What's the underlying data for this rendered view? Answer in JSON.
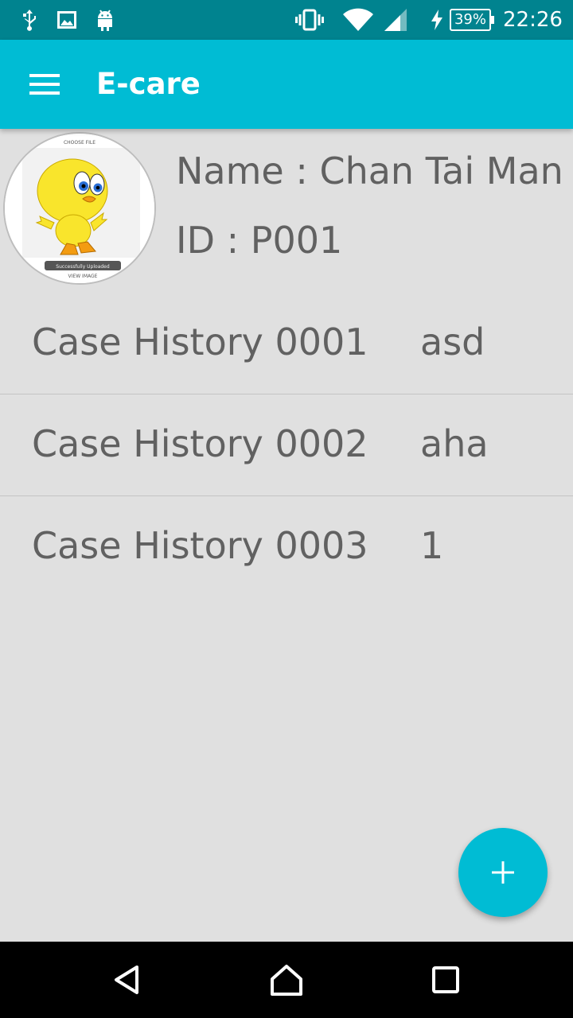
{
  "status_bar": {
    "icons": [
      "usb-icon",
      "image-icon",
      "android-icon",
      "vibrate-icon",
      "wifi-icon",
      "signal-icon",
      "charging-icon"
    ],
    "battery_label": "39%",
    "time": "22:26"
  },
  "app_bar": {
    "menu_icon": "menu-icon",
    "title": "E-care",
    "color": "#00bcd4"
  },
  "profile": {
    "avatar_icon": "avatar-image",
    "avatar_caption_top": "CHOOSE FILE",
    "avatar_caption_button": "Successfully Uploaded",
    "avatar_caption_bottom": "VIEW IMAGE",
    "name_line": "Name : Chan Tai Man",
    "id_line": "ID : P001"
  },
  "cases": [
    {
      "title": "Case History 0001",
      "value": "asd"
    },
    {
      "title": "Case History 0002",
      "value": "aha"
    },
    {
      "title": "Case History 0003",
      "value": "1"
    }
  ],
  "fab": {
    "icon": "plus-icon",
    "label": "+"
  },
  "nav_bar": {
    "back_icon": "back-icon",
    "home_icon": "home-icon",
    "recents_icon": "recents-icon"
  }
}
